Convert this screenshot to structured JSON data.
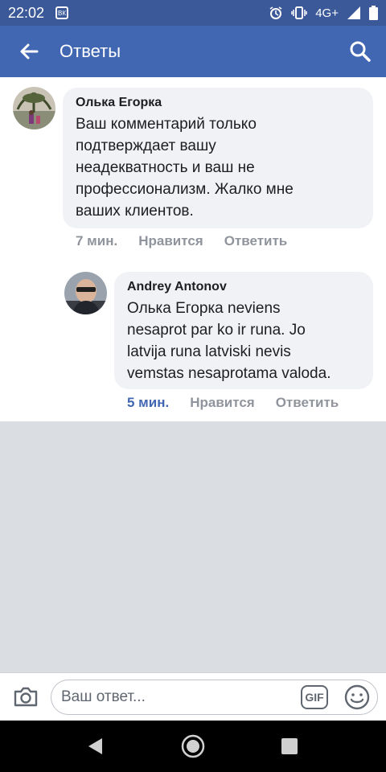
{
  "status_bar": {
    "time": "22:02",
    "app_icon_label": "ВК",
    "network": "4G+",
    "icons": [
      "alarm-icon",
      "vibrate-icon",
      "signal-icon",
      "battery-icon"
    ]
  },
  "toolbar": {
    "title": "Ответы",
    "back_icon": "arrow-left-icon",
    "search_icon": "search-icon"
  },
  "comments": [
    {
      "author": "Олька Егорка",
      "text": "Ваш комментарий только\nподтверждает вашу\nнеадекватность и ваш не\nпрофессионализм. Жалко мне\nваших клиентов.",
      "time": "7 мин.",
      "like_label": "Нравится",
      "reply_label": "Ответить"
    },
    {
      "author": "Andrey Antonov",
      "text": "Олька Егорка neviens\nnesaprot par ko ir runa. Jo\nlatvija runa latviski nevis\nvemstas nesaprotama valoda.",
      "time": "5 мин.",
      "like_label": "Нравится",
      "reply_label": "Ответить"
    }
  ],
  "composer": {
    "placeholder": "Ваш ответ...",
    "gif_label": "GIF",
    "camera_icon": "camera-icon",
    "emoji_icon": "emoji-icon"
  },
  "nav": {
    "icons": [
      "back-triangle-icon",
      "home-circle-icon",
      "recents-square-icon"
    ]
  }
}
